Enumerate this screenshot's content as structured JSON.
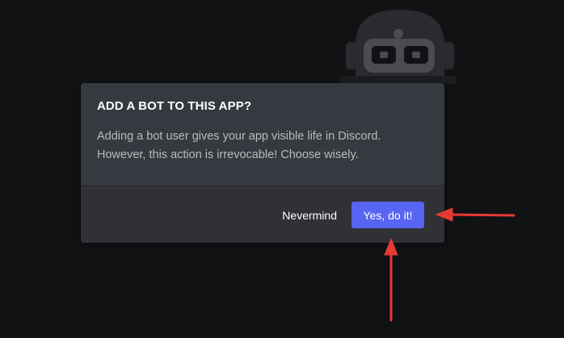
{
  "background": {
    "color": "#111214",
    "illustration": "robot-icon"
  },
  "dialog": {
    "title": "ADD A BOT TO THIS APP?",
    "description": "Adding a bot user gives your app visible life in Discord. However, this action is irrevocable! Choose wisely.",
    "cancel_label": "Nevermind",
    "confirm_label": "Yes, do it!",
    "colors": {
      "body": "#36393f",
      "footer": "#2f3136",
      "confirm": "#5865f2",
      "title": "#ffffff",
      "text": "#b9bbbe"
    }
  },
  "annotations": {
    "arrow_color": "#e53935",
    "arrows": [
      "arrow-right-to-button",
      "arrow-up-to-button"
    ]
  }
}
